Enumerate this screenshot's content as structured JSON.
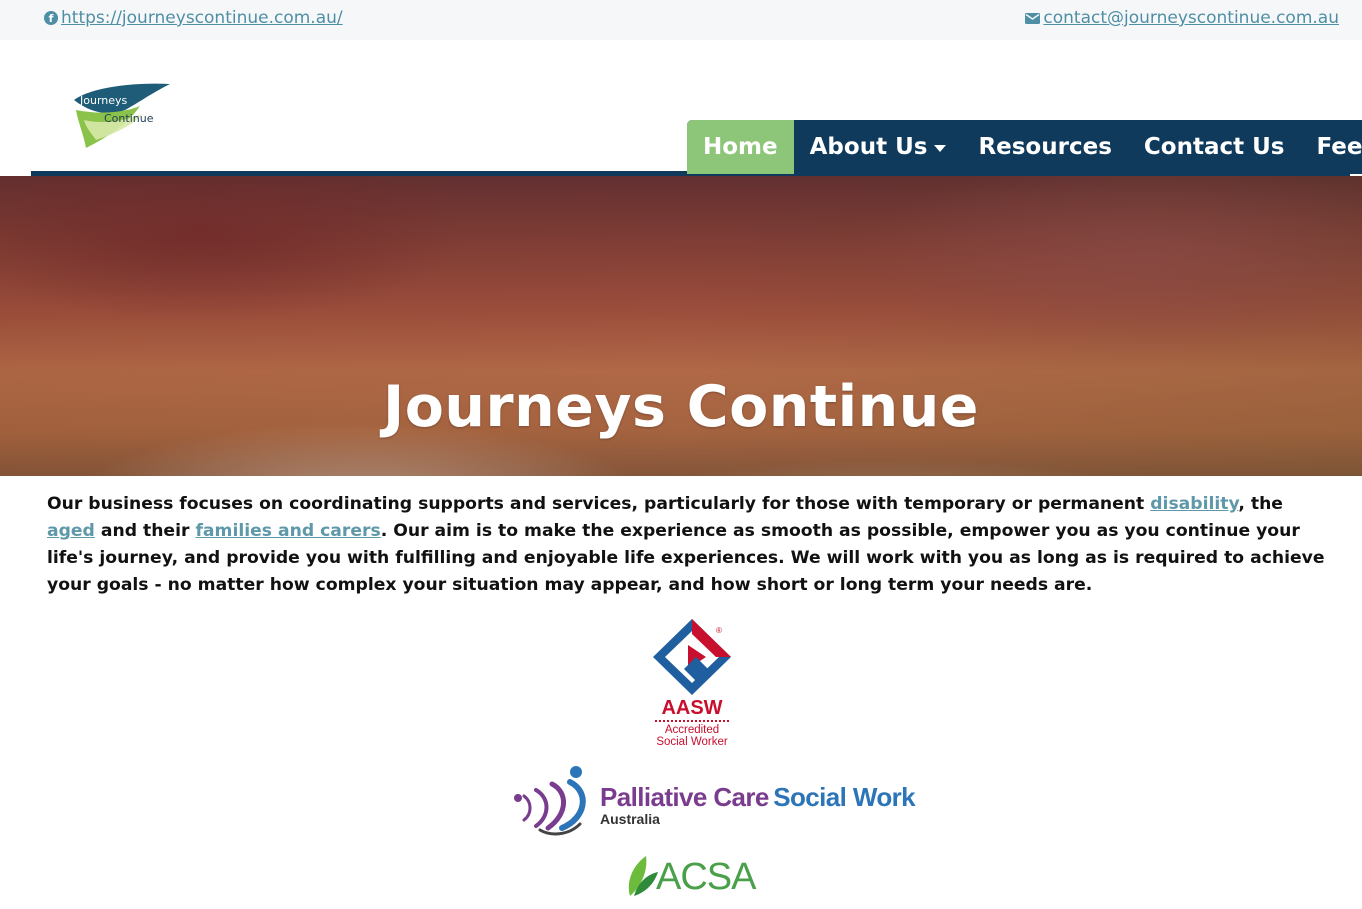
{
  "topbar": {
    "facebook_url": "https://journeyscontinue.com.au/",
    "email": "contact@journeyscontinue.com.au"
  },
  "logo": {
    "line1": "Journeys",
    "line2": "Continue"
  },
  "nav": {
    "items": [
      {
        "label": "Home",
        "active": true
      },
      {
        "label": "About Us",
        "dropdown": true
      },
      {
        "label": "Resources"
      },
      {
        "label": "Contact Us"
      },
      {
        "label": "Fees"
      }
    ]
  },
  "hero": {
    "title": "Journeys Continue"
  },
  "intro": {
    "part1": "Our business focuses on coordinating supports and services, particularly for those with temporary or permanent ",
    "link_disability": "disability",
    "part2": ", the ",
    "link_aged": "aged",
    "part3": " and their ",
    "link_families": "families and carers",
    "part4": ". Our aim is to make the experience as smooth as possible, empower you as you continue your life's journey, and provide you with fulfilling and enjoyable life experiences. We will work with you as long as is required to achieve your goals - no matter how complex your situation may appear, and how short or long term your needs are."
  },
  "badges": {
    "aasw": {
      "name": "AASW",
      "line1": "Accredited",
      "line2": "Social Worker",
      "mark": "®"
    },
    "pcsw": {
      "part1": "Palliative Care",
      "part2": "Social Work",
      "sub": "Australia"
    },
    "acsa": {
      "name": "ACSA"
    }
  },
  "colors": {
    "nav_bg": "#0f3a5c",
    "nav_active": "#8ec679",
    "link": "#5e98a9"
  }
}
